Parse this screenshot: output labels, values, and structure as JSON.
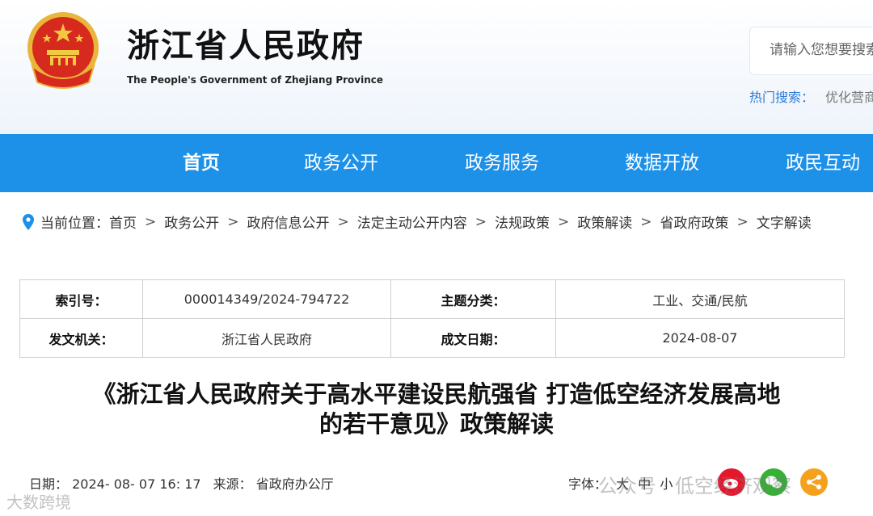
{
  "site": {
    "title": "浙江省人民政府",
    "subtitle": "The People's Government of Zhejiang Province"
  },
  "search": {
    "placeholder": "请输入您想要搜索的内容",
    "hot_label": "热门搜索：",
    "hot_keywords": [
      "优化营商环境"
    ]
  },
  "nav": {
    "items": [
      {
        "label": "首页",
        "active": true
      },
      {
        "label": "政务公开"
      },
      {
        "label": "政务服务"
      },
      {
        "label": "数据开放"
      },
      {
        "label": "政民互动"
      }
    ],
    "background": "#1d90e8"
  },
  "breadcrumb": {
    "prefix": "当前位置：",
    "items": [
      "首页",
      "政务公开",
      "政府信息公开",
      "法定主动公开内容",
      "法规政策",
      "政策解读",
      "省政府政策",
      "文字解读"
    ],
    "separator": ">"
  },
  "meta": {
    "index_label": "索引号：",
    "index_value": "000014349/2024-794722",
    "topic_label": "主题分类：",
    "topic_value": "工业、交通/民航",
    "issuer_label": "发文机关：",
    "issuer_value": "浙江省人民政府",
    "date_label": "成文日期：",
    "date_value": "2024-08-07"
  },
  "article": {
    "title_line1": "《浙江省人民政府关于高水平建设民航强省 打造低空经济发展高地",
    "title_line2": "的若干意见》政策解读",
    "date_label": "日期：",
    "date": "2024- 08- 07 16: 17",
    "source_label": "来源：",
    "source": "省政府办公厅",
    "font_label": "字体：",
    "font_sizes": [
      "大",
      "中",
      "小"
    ]
  },
  "watermarks": {
    "left": "大数跨境",
    "right": "公众号 · 低空经济观察"
  },
  "colors": {
    "accent": "#2d7ad6",
    "weibo": "#e6162d",
    "wechat": "#35b135",
    "other": "#f4a21e"
  }
}
